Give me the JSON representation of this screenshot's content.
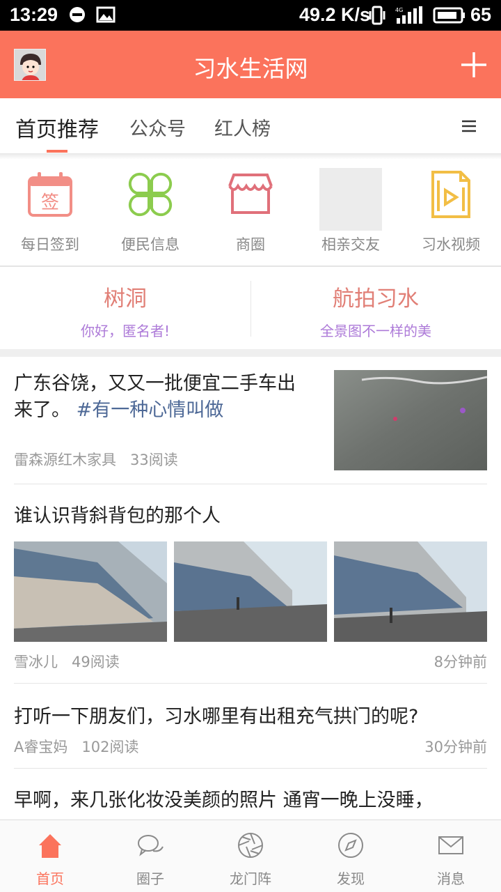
{
  "status_bar": {
    "time": "13:29",
    "speed": "49.2 K/s",
    "battery": "65",
    "network": "4G"
  },
  "header": {
    "title": "习水生活网",
    "avatar_icon": "user-avatar",
    "add_icon": "plus-icon",
    "accent_color": "#fb735c"
  },
  "tabs": {
    "items": [
      {
        "label": "首页推荐",
        "active": true
      },
      {
        "label": "公众号",
        "active": false
      },
      {
        "label": "红人榜",
        "active": false
      }
    ],
    "menu_icon": "hamburger-icon"
  },
  "quick_links": [
    {
      "label": "每日签到",
      "icon": "sign-in-calendar-icon",
      "glyph": "签"
    },
    {
      "label": "便民信息",
      "icon": "clover-icon"
    },
    {
      "label": "商圈",
      "icon": "shop-awning-icon"
    },
    {
      "label": "相亲交友",
      "icon": "image-placeholder"
    },
    {
      "label": "习水视频",
      "icon": "video-file-icon"
    }
  ],
  "features": [
    {
      "title": "树洞",
      "subtitle": "你好，匿名者!"
    },
    {
      "title": "航拍习水",
      "subtitle": "全景图不一样的美"
    }
  ],
  "feed": {
    "post1": {
      "text": "广东谷饶，又又一批便宜二手车出来了。",
      "hashtag": "#有一种心情叫做",
      "author": "雷森源红木家具",
      "reads": "33阅读"
    },
    "post2": {
      "title": "谁认识背斜背包的那个人",
      "author": "雪冰儿",
      "reads": "49阅读",
      "time": "8分钟前"
    },
    "post3": {
      "title": "打听一下朋友们，习水哪里有出租充气拱门的呢?",
      "author": "A睿宝妈",
      "reads": "102阅读",
      "time": "30分钟前"
    },
    "post4": {
      "title": "早啊，来几张化妆没美颜的照片 通宵一晚上没睡，"
    }
  },
  "bottom_nav": [
    {
      "label": "首页",
      "icon": "home-icon",
      "active": true
    },
    {
      "label": "圈子",
      "icon": "chat-bubbles-icon",
      "active": false
    },
    {
      "label": "龙门阵",
      "icon": "aperture-icon",
      "active": false
    },
    {
      "label": "发现",
      "icon": "compass-icon",
      "active": false
    },
    {
      "label": "消息",
      "icon": "envelope-icon",
      "active": false
    }
  ]
}
